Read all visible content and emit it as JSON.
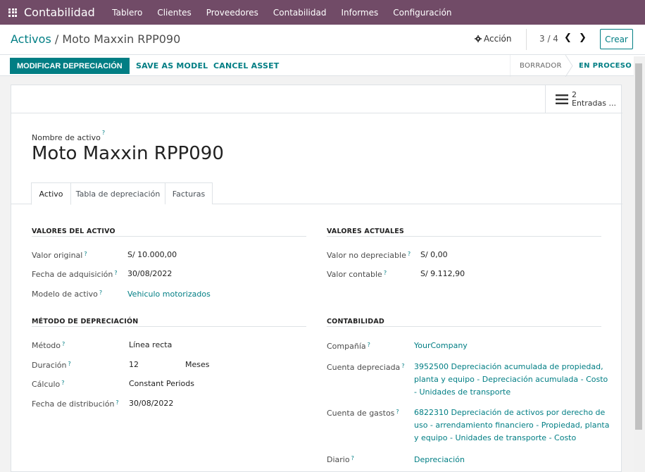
{
  "app": {
    "brand": "Contabilidad",
    "menu": [
      "Tablero",
      "Clientes",
      "Proveedores",
      "Contabilidad",
      "Informes",
      "Configuración"
    ]
  },
  "breadcrumb": {
    "parent": "Activos",
    "separator": " / ",
    "current": "Moto Maxxin RPP090"
  },
  "control": {
    "action": "Acción",
    "pager": "3 / 4",
    "prev": "❮",
    "next": "❯",
    "create": "Crear"
  },
  "statusbar": {
    "buttons": [
      "MODIFICAR DEPRECIACIÓN",
      "SAVE AS MODEL",
      "CANCEL ASSET"
    ],
    "states": [
      "BORRADOR",
      "EN PROCESO"
    ]
  },
  "smart_button": {
    "count": "2",
    "label": "Entradas ..."
  },
  "form": {
    "name_label": "Nombre de activo",
    "name": "Moto Maxxin RPP090",
    "tabs": [
      "Activo",
      "Tabla de depreciación",
      "Facturas"
    ],
    "sections": {
      "asset_values": {
        "title": "VALORES DEL ACTIVO",
        "fields": [
          {
            "label": "Valor original",
            "value": "S/ 10.000,00"
          },
          {
            "label": "Fecha de adquisición",
            "value": "30/08/2022"
          },
          {
            "label": "Modelo de activo",
            "value": "Vehiculo motorizados"
          }
        ]
      },
      "current_values": {
        "title": "VALORES ACTUALES",
        "fields": [
          {
            "label": "Valor no depreciable",
            "value": "S/ 0,00"
          },
          {
            "label": "Valor contable",
            "value": "S/ 9.112,90"
          }
        ]
      },
      "depreciation": {
        "title": "MÉTODO DE DEPRECIACIÓN",
        "fields": [
          {
            "label": "Método",
            "value": "Línea recta"
          },
          {
            "label": "Duración",
            "value": "12",
            "unit": "Meses"
          },
          {
            "label": "Cálculo",
            "value": "Constant Periods"
          },
          {
            "label": "Fecha de distribución",
            "value": "30/08/2022"
          }
        ]
      },
      "accounting": {
        "title": "CONTABILIDAD",
        "fields": [
          {
            "label": "Compañía",
            "value": "YourCompany"
          },
          {
            "label": "Cuenta depreciada",
            "lines": [
              "3952500 Depreciación acumulada de propiedad,",
              "planta y equipo - Depreciación acumulada - Costo",
              "- Unidades de transporte"
            ]
          },
          {
            "label": "Cuenta de gastos",
            "lines": [
              "6822310 Depreciación de activos por derecho de",
              "uso - arrendamiento financiero - Propiedad, planta",
              "y equipo - Unidades de transporte - Costo"
            ]
          },
          {
            "label": "Diario",
            "value": "Depreciación"
          }
        ]
      }
    }
  },
  "help_mark": "?",
  "colors": {
    "navbar": "#714b67",
    "accent": "#017e84"
  }
}
